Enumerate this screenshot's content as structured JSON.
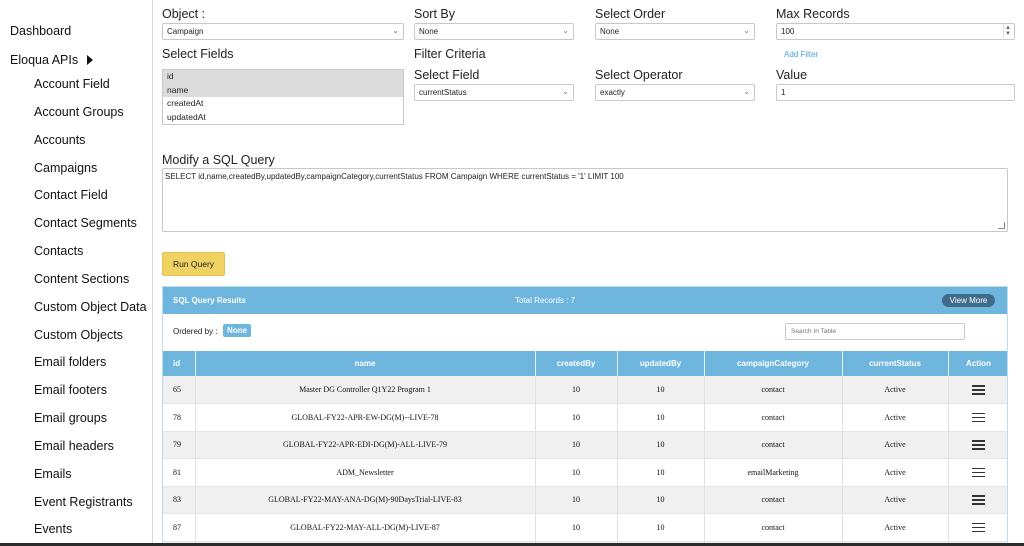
{
  "sidebar": {
    "dashboard": "Dashboard",
    "apis_label": "Eloqua APIs",
    "items": [
      "Account Field",
      "Account Groups",
      "Accounts",
      "Campaigns",
      "Contact Field",
      "Contact Segments",
      "Contacts",
      "Content Sections",
      "Custom Object Data",
      "Custom Objects",
      "Email folders",
      "Email footers",
      "Email groups",
      "Email headers",
      "Emails",
      "Event Registrants",
      "Events"
    ]
  },
  "form": {
    "object_label": "Object :",
    "object_value": "Campaign",
    "sort_by_label": "Sort By",
    "sort_by_value": "None",
    "select_order_label": "Select Order",
    "select_order_value": "None",
    "max_records_label": "Max Records",
    "max_records_value": "100",
    "select_fields_label": "Select Fields",
    "fields": [
      "id",
      "name",
      "createdAt",
      "updatedAt"
    ],
    "filter_criteria_label": "Filter Criteria",
    "add_filter": "Add Filter",
    "select_field_label": "Select Field",
    "select_field_value": "currentStatus",
    "select_operator_label": "Select Operator",
    "select_operator_value": "exactly",
    "value_label": "Value",
    "value_value": "1",
    "sql_label": "Modify a SQL Query",
    "sql_value": "SELECT id,name,createdBy,updatedBy,campaignCategory,currentStatus FROM Campaign  WHERE  currentStatus = '1'  LIMIT 100",
    "run_button": "Run Query"
  },
  "results": {
    "title": "SQL Query Results",
    "total": "Total Records : 7",
    "view_more": "View More",
    "ordered_by_label": "Ordered by :",
    "ordered_by_value": "None",
    "search_placeholder": "Search In Table",
    "columns": [
      "id",
      "name",
      "createdBy",
      "updatedBy",
      "campaignCategory",
      "currentStatus",
      "Action"
    ],
    "rows": [
      {
        "id": "65",
        "name": "Master DG Controller Q1Y22 Program 1",
        "createdBy": "10",
        "updatedBy": "10",
        "campaignCategory": "contact",
        "currentStatus": "Active"
      },
      {
        "id": "78",
        "name": "GLOBAL-FY22-APR-EW-DG(M)--LIVE-78",
        "createdBy": "10",
        "updatedBy": "10",
        "campaignCategory": "contact",
        "currentStatus": "Active"
      },
      {
        "id": "79",
        "name": "GLOBAL-FY22-APR-EDI-DG(M)-ALL-LIVE-79",
        "createdBy": "10",
        "updatedBy": "10",
        "campaignCategory": "contact",
        "currentStatus": "Active"
      },
      {
        "id": "81",
        "name": "ADM_Newsletter",
        "createdBy": "10",
        "updatedBy": "10",
        "campaignCategory": "emailMarketing",
        "currentStatus": "Active"
      },
      {
        "id": "83",
        "name": "GLOBAL-FY22-MAY-ANA-DG(M)-90DaysTrial-LIVE-83",
        "createdBy": "10",
        "updatedBy": "10",
        "campaignCategory": "contact",
        "currentStatus": "Active"
      },
      {
        "id": "87",
        "name": "GLOBAL-FY22-MAY-ALL-DG(M)-LIVE-87",
        "createdBy": "10",
        "updatedBy": "10",
        "campaignCategory": "contact",
        "currentStatus": "Active"
      },
      {
        "id": "",
        "name": "",
        "createdBy": "",
        "updatedBy": "",
        "campaignCategory": "",
        "currentStatus": ""
      }
    ]
  }
}
